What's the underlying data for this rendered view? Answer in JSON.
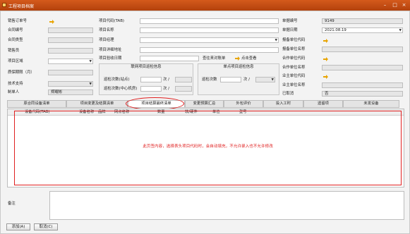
{
  "window": {
    "title": "工程项目档案"
  },
  "left": {
    "sales_order_no": "销售订单号",
    "contract_no": "合同编号",
    "contract_type": "合同类型",
    "salesperson": "销售员",
    "project_area": "项目区域",
    "warranty": "质保期限（月）",
    "tech_support": "技术支持",
    "creator": "制单人",
    "creator_value": "郑耀彬"
  },
  "middle": {
    "project_code": "项目代码(TAB)",
    "project_name": "项目名称",
    "project_manager": "项目经理",
    "project_address": "项目详细地址",
    "acceptance_date": "项目验收日期",
    "check_bill": "查往来对账单",
    "view_points": "点击查看"
  },
  "group1": {
    "title": "联网项目巡检信息",
    "row1": "巡检次数(站点)",
    "row2": "巡检次数(中心机房)",
    "unit": "次 /"
  },
  "group2": {
    "title": "单点项目巡检信息",
    "row1": "巡检次数",
    "unit": "次 /"
  },
  "right": {
    "doc_no": "单据编号",
    "doc_no_value": "9149",
    "doc_date": "单据日期",
    "doc_date_value": "2021.08.19",
    "report_unit_code": "报备单位代码",
    "report_unit_name": "报备单位名称",
    "partner_code": "合作单位代码",
    "partner_name": "合作单位名称",
    "owner_code": "业主单位代码",
    "owner_name": "业主单位名称",
    "finished": "已取消",
    "finished_value": "否"
  },
  "tabs": [
    "原合同设备清单",
    "项目变更及结算清单",
    "项目结算最终清单",
    "变更预算汇总",
    "外包评价",
    "投入工时",
    "遗留项",
    "未发设备"
  ],
  "table": {
    "headers": [
      "设备代码(TAB)",
      "设备名称",
      "品牌",
      "网点名称",
      "数量",
      "软/硬件",
      "单位",
      "型号"
    ],
    "note": "此页签内容，选择表头项目代码时，会自动填充，不允许录入也不允许修改"
  },
  "remark": {
    "label": "备注"
  },
  "buttons": {
    "add": "添加(A)",
    "cancel": "取消(C)"
  },
  "colors": {
    "titlebar": "#c84d14",
    "highlight": "#e02020",
    "icon_arrow": "#e8a400"
  },
  "icons": [
    "arrow-right-icon",
    "dropdown-icon",
    "minimize-icon",
    "maximize-icon",
    "close-icon"
  ]
}
